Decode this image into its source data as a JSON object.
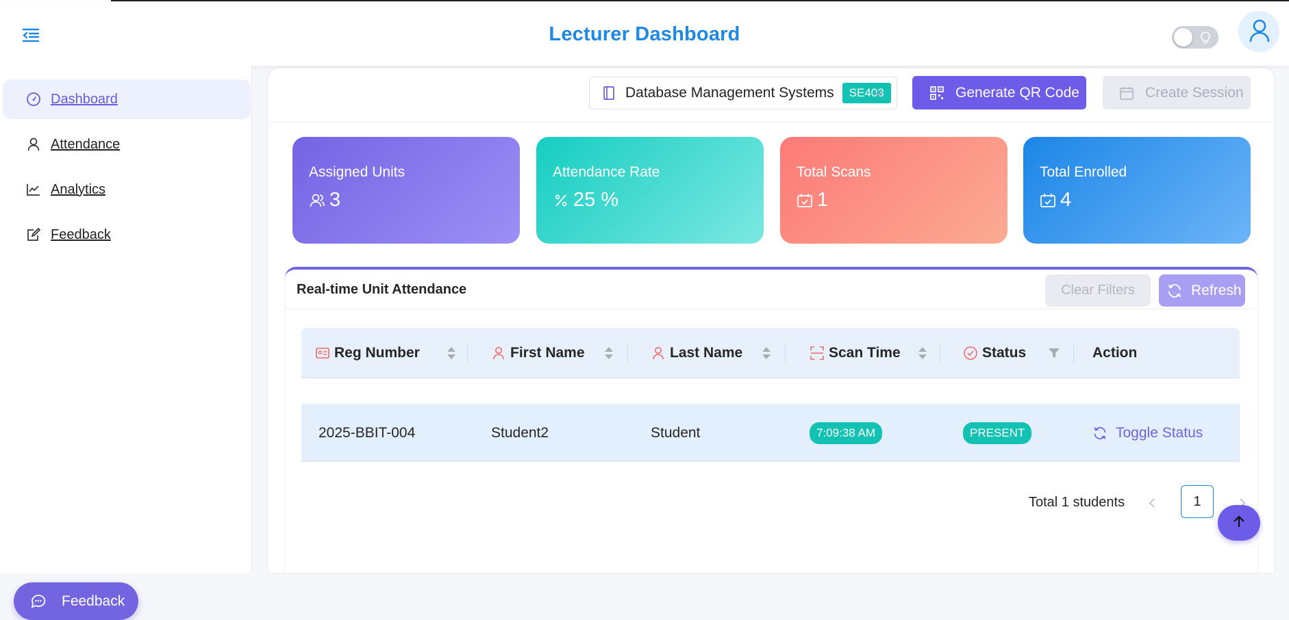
{
  "header": {
    "title": "Lecturer Dashboard",
    "menu_icon": "menu-fold-icon",
    "theme_icon": "bulb-icon",
    "avatar_icon": "user-icon"
  },
  "sidebar": {
    "items": [
      {
        "label": "Dashboard",
        "icon": "dashboard-icon",
        "active": true
      },
      {
        "label": "Attendance",
        "icon": "user-icon",
        "active": false
      },
      {
        "label": "Analytics",
        "icon": "line-chart-icon",
        "active": false
      },
      {
        "label": "Feedback",
        "icon": "form-icon",
        "active": false
      }
    ],
    "feedback_button": "Feedback"
  },
  "toolbar": {
    "unit_name": "Database Management Systems",
    "unit_code": "SE403",
    "generate_qr": "Generate QR Code",
    "create_session": "Create Session"
  },
  "stats": [
    {
      "title": "Assigned Units",
      "value": "3",
      "icon": "team-icon"
    },
    {
      "title": "Attendance Rate",
      "value": "25 %",
      "icon": "percentage-icon"
    },
    {
      "title": "Total Scans",
      "value": "1",
      "icon": "schedule-icon"
    },
    {
      "title": "Total Enrolled",
      "value": "4",
      "icon": "schedule-icon"
    }
  ],
  "attendance": {
    "title": "Real-time Unit Attendance",
    "clear_filters": "Clear Filters",
    "refresh": "Refresh",
    "columns": [
      "Reg Number",
      "First Name",
      "Last Name",
      "Scan Time",
      "Status",
      "Action"
    ],
    "rows": [
      {
        "reg": "2025-BBIT-004",
        "first": "Student2",
        "last": "Student",
        "scan_time": "7:09:38 AM",
        "status": "PRESENT",
        "action": "Toggle Status"
      }
    ],
    "total": "Total 1 students",
    "page": "1"
  },
  "colors": {
    "primary": "#6c5ce7",
    "title_blue": "#1e88e5",
    "teal": "#13c2b2",
    "coral": "#fd7a78"
  }
}
